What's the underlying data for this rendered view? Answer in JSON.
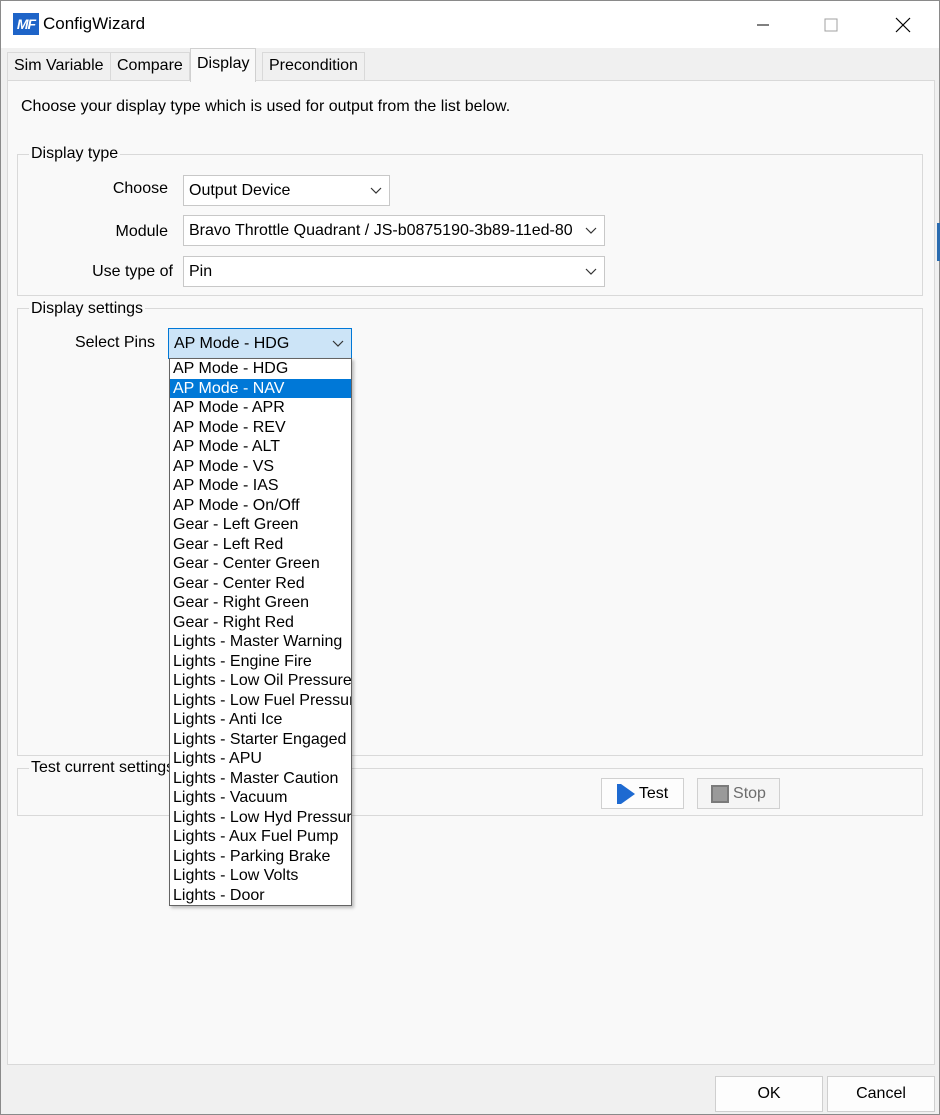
{
  "window": {
    "title": "ConfigWizard",
    "logo_text": "MF",
    "controls": [
      "minimize-icon",
      "maximize-icon",
      "close-icon"
    ]
  },
  "tabs": [
    {
      "label": "Sim Variable",
      "active": false
    },
    {
      "label": "Compare",
      "active": false
    },
    {
      "label": "Display",
      "active": true
    },
    {
      "label": "Precondition",
      "active": false
    }
  ],
  "intro_text": "Choose your display type which is used for output from the list below.",
  "display_type": {
    "group_label": "Display type",
    "choose_label": "Choose",
    "choose_value": "Output Device",
    "module_label": "Module",
    "module_value": "Bravo Throttle Quadrant / JS-b0875190-3b89-11ed-80",
    "use_type_label": "Use type of",
    "use_type_value": "Pin"
  },
  "display_settings": {
    "group_label": "Display settings",
    "select_pins_label": "Select Pins",
    "select_pins_value": "AP Mode - HDG",
    "dropdown_open": true,
    "highlighted_option": "AP Mode - NAV",
    "options": [
      "AP Mode - HDG",
      "AP Mode - NAV",
      "AP Mode - APR",
      "AP Mode - REV",
      "AP Mode - ALT",
      "AP Mode - VS",
      "AP Mode - IAS",
      "AP Mode - On/Off",
      "Gear - Left Green",
      "Gear - Left Red",
      "Gear - Center Green",
      "Gear - Center Red",
      "Gear - Right Green",
      "Gear - Right Red",
      "Lights - Master Warning",
      "Lights - Engine Fire",
      "Lights - Low Oil Pressure",
      "Lights - Low Fuel Pressure",
      "Lights - Anti Ice",
      "Lights - Starter Engaged",
      "Lights - APU",
      "Lights - Master Caution",
      "Lights - Vacuum",
      "Lights - Low Hyd Pressure",
      "Lights - Aux Fuel Pump",
      "Lights - Parking Brake",
      "Lights - Low Volts",
      "Lights - Door"
    ]
  },
  "test_settings": {
    "group_label": "Test current settings",
    "test_button": "Test",
    "stop_button": "Stop",
    "stop_enabled": false
  },
  "footer": {
    "ok_label": "OK",
    "cancel_label": "Cancel"
  },
  "colors": {
    "accent": "#0078d7",
    "logo": "#1e64c8",
    "play_icon": "#1e6ad1"
  }
}
